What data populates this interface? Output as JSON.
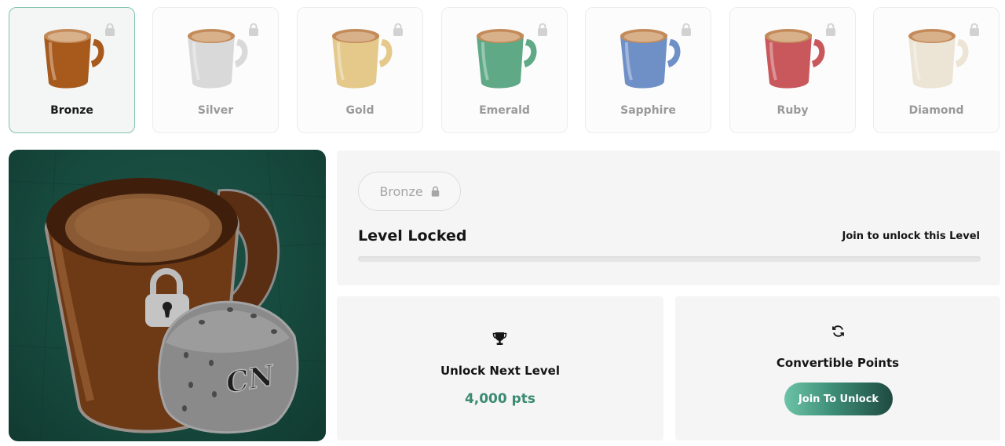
{
  "tiers": [
    {
      "label": "Bronze",
      "selected": true,
      "locked": true,
      "color": "#a85a1c"
    },
    {
      "label": "Silver",
      "selected": false,
      "locked": true,
      "color": "#d6d6d6"
    },
    {
      "label": "Gold",
      "selected": false,
      "locked": true,
      "color": "#e2c88a"
    },
    {
      "label": "Emerald",
      "selected": false,
      "locked": true,
      "color": "#5da884"
    },
    {
      "label": "Sapphire",
      "selected": false,
      "locked": true,
      "color": "#6d8fc4"
    },
    {
      "label": "Ruby",
      "selected": false,
      "locked": true,
      "color": "#c9565a"
    },
    {
      "label": "Diamond",
      "selected": false,
      "locked": true,
      "color": "#eee6d8"
    }
  ],
  "hero": {
    "icons": [
      "mug-icon",
      "padlock-icon",
      "dice-icon"
    ],
    "badge_text": "CN"
  },
  "level": {
    "pill_label": "Bronze",
    "pill_icon": "lock-icon",
    "title": "Level Locked",
    "hint": "Join to unlock this Level",
    "progress": 0
  },
  "unlock_card": {
    "icon": "trophy-icon",
    "title": "Unlock Next Level",
    "value": "4,000 pts"
  },
  "convert_card": {
    "icon": "refresh-icon",
    "title": "Convertible Points",
    "button_label": "Join To Unlock"
  },
  "colors": {
    "accent": "#3b8a72",
    "active_border": "#7fc4ad",
    "hero_bg": "#174a3e"
  }
}
